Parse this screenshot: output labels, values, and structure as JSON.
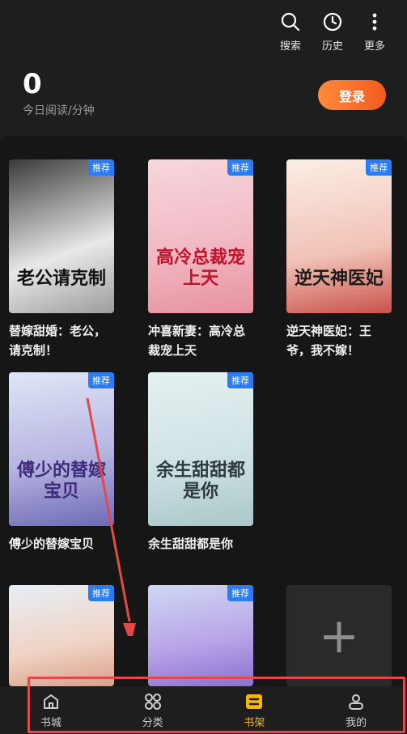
{
  "top_actions": [
    {
      "label": "搜索",
      "icon": "search-icon"
    },
    {
      "label": "历史",
      "icon": "clock-icon"
    },
    {
      "label": "更多",
      "icon": "more-vertical-icon"
    }
  ],
  "stats": {
    "reading_minutes": "0",
    "caption": "今日阅读/分钟"
  },
  "login_label": "登录",
  "tag_label": "推荐",
  "books": [
    {
      "title": "替嫁甜婚：老公，请克制！",
      "cover_text": "老公请克制"
    },
    {
      "title": "冲喜新妻：高冷总裁宠上天",
      "cover_text": "高冷总裁宠上天"
    },
    {
      "title": "逆天神医妃：王爷，我不嫁！",
      "cover_text": "逆天神医妃"
    },
    {
      "title": "傅少的替嫁宝贝",
      "cover_text": "傅少的替嫁宝贝"
    },
    {
      "title": "余生甜甜都是你",
      "cover_text": "余生甜甜都是你"
    },
    {
      "title": "",
      "cover_text": ""
    },
    {
      "title": "",
      "cover_text": ""
    }
  ],
  "add_label": "+",
  "nav": [
    {
      "label": "书城",
      "icon": "home-icon"
    },
    {
      "label": "分类",
      "icon": "grid-icon"
    },
    {
      "label": "书架",
      "icon": "bookshelf-icon",
      "active": true
    },
    {
      "label": "我的",
      "icon": "profile-icon"
    }
  ],
  "colors": {
    "accent": "#f6b800",
    "login": "#f45b1e",
    "tag": "#2b7bf3",
    "highlight": "#e24a4a"
  }
}
